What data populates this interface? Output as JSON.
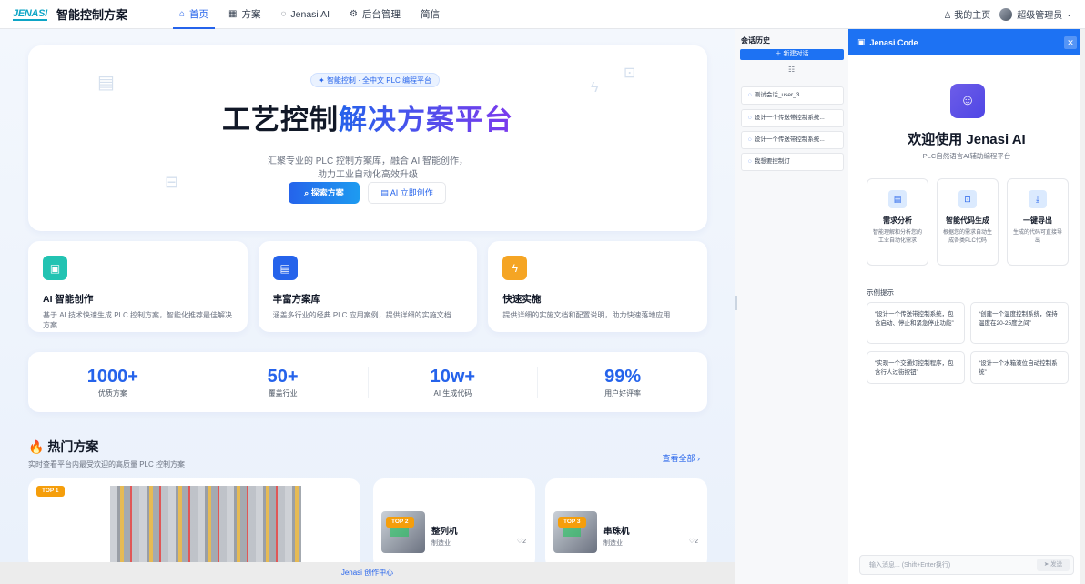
{
  "nav": {
    "logo": "JENASI",
    "brand": "智能控制方案",
    "items": [
      {
        "label": "首页",
        "icon": "home-icon",
        "active": true
      },
      {
        "label": "方案",
        "icon": "grid-icon",
        "active": false
      },
      {
        "label": "Jenasi AI",
        "icon": "chat-icon",
        "active": false
      },
      {
        "label": "后台管理",
        "icon": "gear-icon",
        "active": false
      },
      {
        "label": "简信",
        "icon": "",
        "active": false
      }
    ],
    "my_home": "我的主页",
    "user": "超级管理员"
  },
  "hero": {
    "badge": "智能控制 · 全中文 PLC 编程平台",
    "title_plain": "工艺控制",
    "title_grad": "解决方案平台",
    "sub_line1": "汇聚专业的 PLC 控制方案库，融合 AI 智能创作，",
    "sub_line2": "助力工业自动化高效升级",
    "btn_search": "探索方案",
    "btn_ai": "AI 立即创作"
  },
  "features": [
    {
      "title": "AI 智能创作",
      "desc": "基于 AI 技术快速生成 PLC 控制方案，智能化推荐最佳解决方案",
      "color": "#22c3b2",
      "icon": "book-icon"
    },
    {
      "title": "丰富方案库",
      "desc": "涵盖多行业的经典 PLC 应用案例，提供详细的实施文档",
      "color": "#2563eb",
      "icon": "list-icon"
    },
    {
      "title": "快速实施",
      "desc": "提供详细的实施文档和配置说明，助力快速落地应用",
      "color": "#f5a524",
      "icon": "bolt-icon"
    }
  ],
  "stats": [
    {
      "value": "1000+",
      "label": "优质方案"
    },
    {
      "value": "50+",
      "label": "覆盖行业"
    },
    {
      "value": "10w+",
      "label": "AI 生成代码"
    },
    {
      "value": "99%",
      "label": "用户好评率"
    }
  ],
  "hot": {
    "title": "热门方案",
    "sub": "实时查看平台内最受欢迎的高质量 PLC 控制方案",
    "view_all": "查看全部",
    "top1_tag": "TOP 1",
    "cards": [
      {
        "tag": "TOP 2",
        "name": "整列机",
        "category": "制造业",
        "likes": "2"
      },
      {
        "tag": "TOP 3",
        "name": "串珠机",
        "category": "制造业",
        "likes": "2"
      }
    ]
  },
  "footer": "Jenasi 创作中心",
  "history": {
    "title": "会话历史",
    "new_chat": "新建对话",
    "items": [
      "测试会话_user_3",
      "设计一个传送带控制系统...",
      "设计一个传送带控制系统...",
      "我想要控制灯"
    ]
  },
  "chat": {
    "header": "Jenasi Code",
    "welcome": "欢迎使用 Jenasi AI",
    "welcome_sub": "PLC自然语言AI辅助编程平台",
    "capabilities": [
      {
        "title": "需求分析",
        "desc": "智能理解和分析您的工业自动化需求",
        "icon": "file-icon"
      },
      {
        "title": "智能代码生成",
        "desc": "根据您的需求自动生成各类PLC代码",
        "icon": "terminal-icon"
      },
      {
        "title": "一键导出",
        "desc": "生成的代码可直接导出",
        "icon": "download-icon"
      }
    ],
    "examples_label": "示例提示",
    "examples": [
      "“设计一个传送带控制系统，包含启动、停止和紧急停止功能”",
      "“创建一个温度控制系统，保持温度在20-25度之间”",
      "“实现一个交通灯控制程序，包含行人过街按钮”",
      "“设计一个水箱液位自动控制系统”"
    ],
    "input_placeholder": "输入消息... (Shift+Enter换行)",
    "send": "发送"
  }
}
